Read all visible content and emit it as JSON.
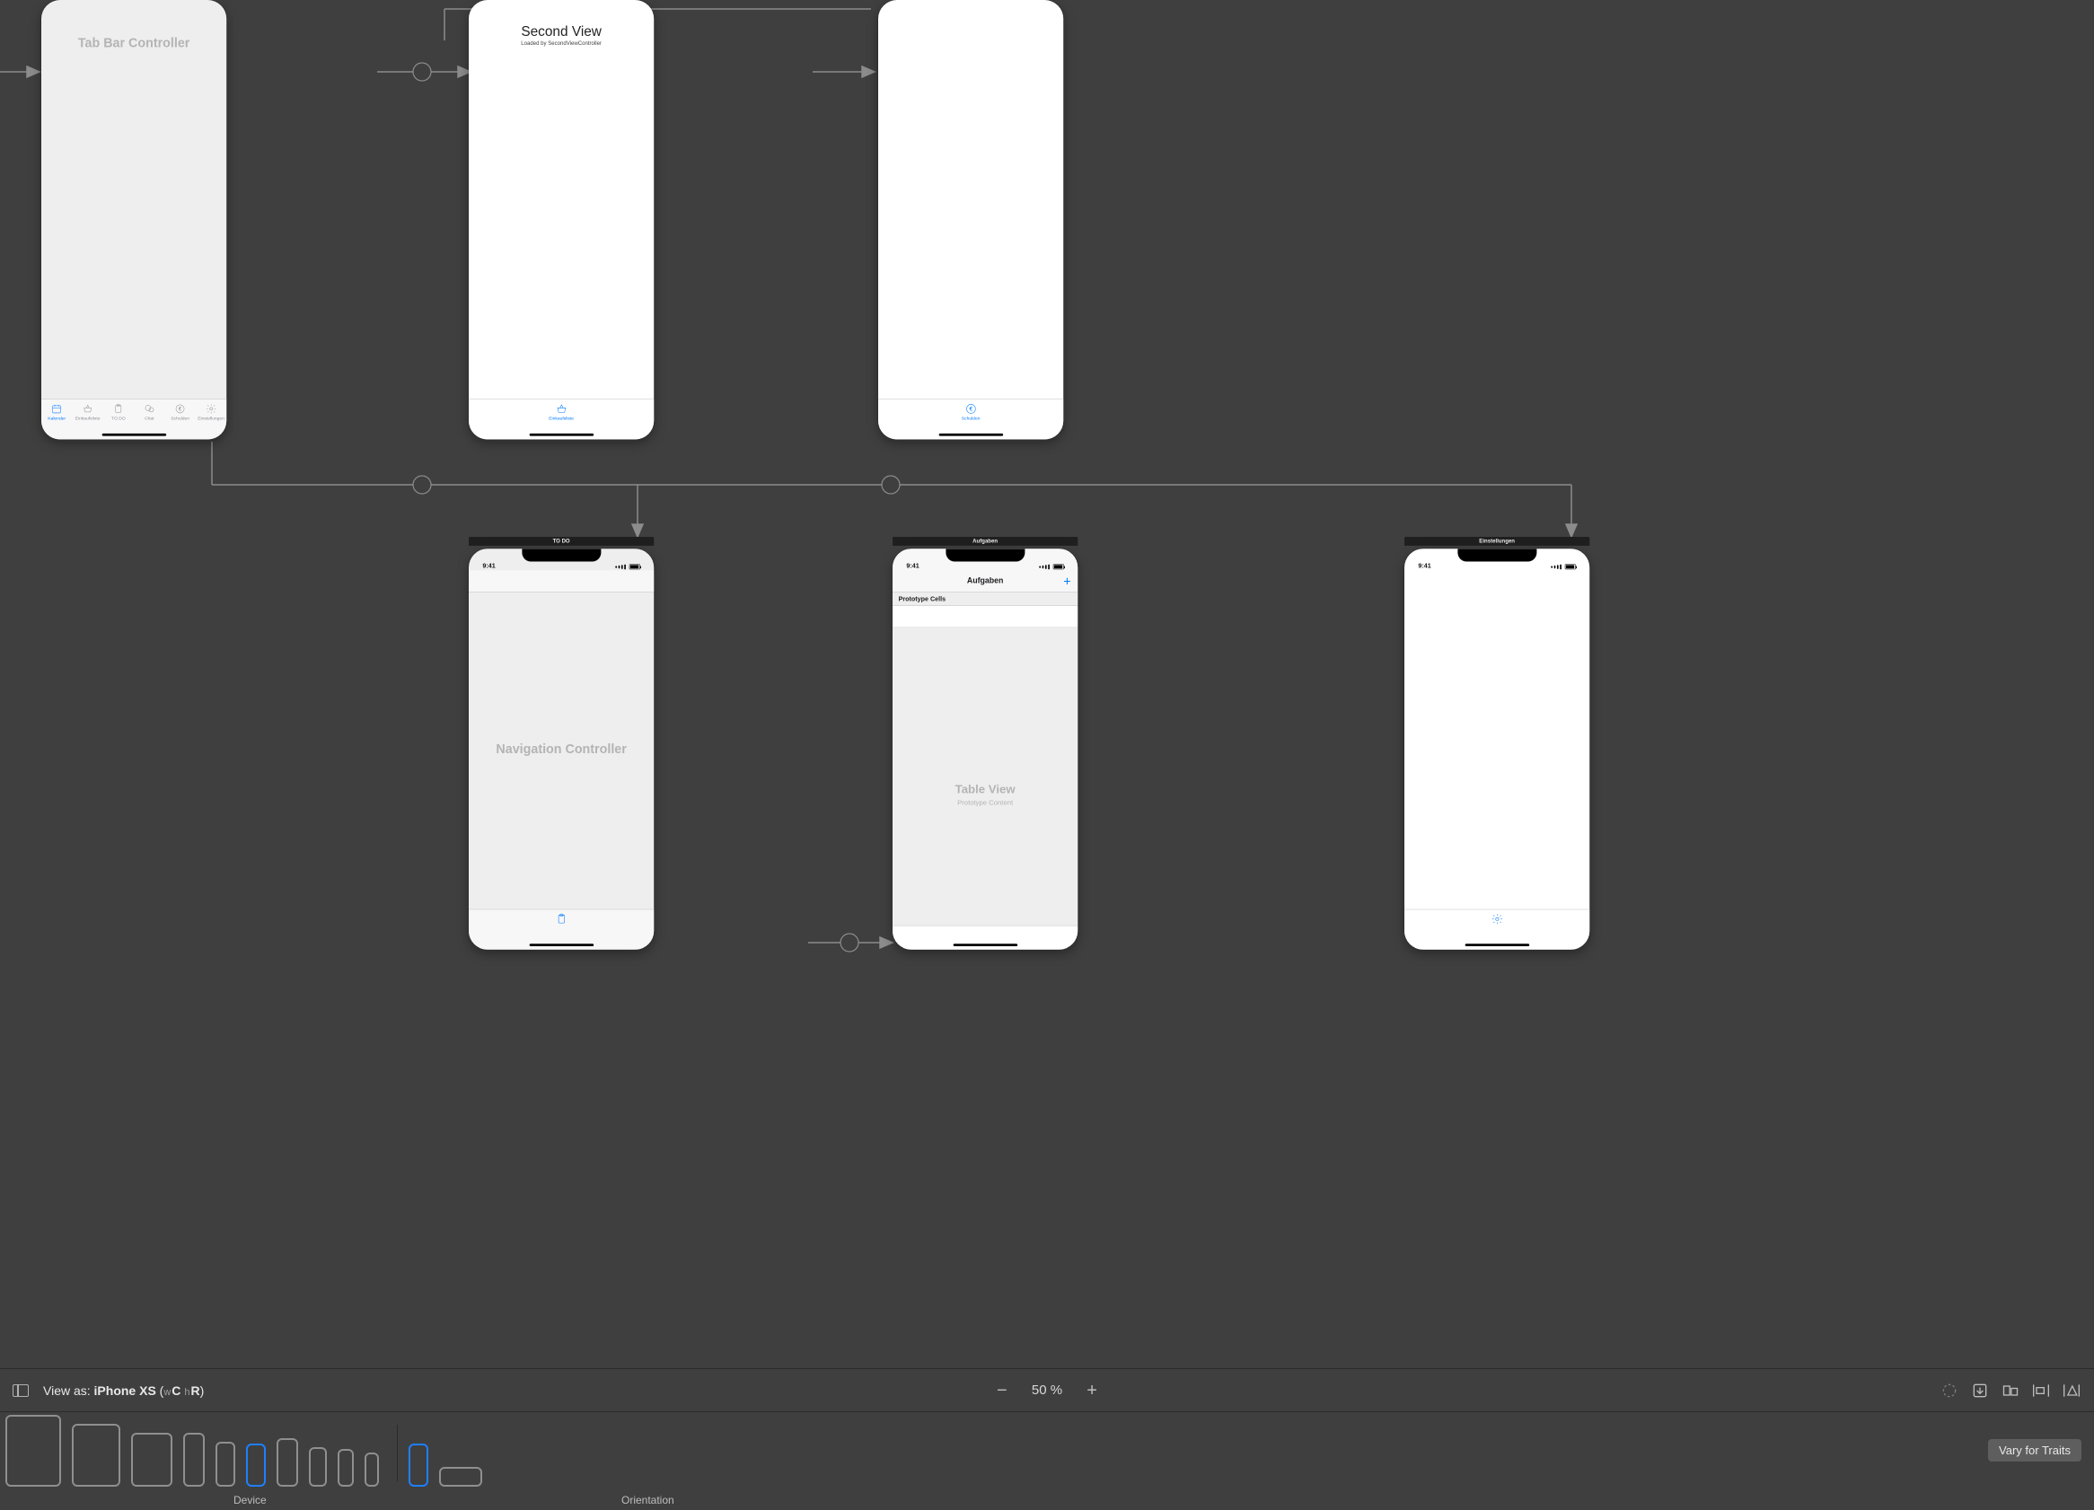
{
  "scenes": {
    "tabbar": {
      "placeholder_title": "Tab Bar Controller",
      "tabs": [
        {
          "label": "Kalender"
        },
        {
          "label": "Einkaufsliste"
        },
        {
          "label": "TO DO"
        },
        {
          "label": "Chat"
        },
        {
          "label": "Schulden"
        },
        {
          "label": "Einstellungen"
        }
      ]
    },
    "second": {
      "headline": "Second View",
      "subline": "Loaded by SecondViewController",
      "tab_label": "Einkaufsliste"
    },
    "schulden": {
      "tab_label": "Schulden"
    },
    "todo_nav": {
      "title": "TO DO",
      "placeholder_title": "Navigation Controller",
      "status_time": "9:41"
    },
    "aufgaben": {
      "title": "Aufgaben",
      "nav_title": "Aufgaben",
      "proto_header": "Prototype Cells",
      "table_label": "Table View",
      "table_sub": "Prototype Content",
      "status_time": "9:41",
      "add_label": "+"
    },
    "einstellungen": {
      "title": "Einstellungen",
      "status_time": "9:41"
    }
  },
  "device_bar": {
    "prefix": "View as: ",
    "device_name": "iPhone XS",
    "trait_w_prefix": "w",
    "trait_w": "C",
    "trait_h_prefix": "h",
    "trait_h": "R"
  },
  "zoom": {
    "percent": "50 %"
  },
  "device_picker": {
    "device_label": "Device",
    "orientation_label": "Orientation"
  },
  "vary_button": "Vary for Traits"
}
